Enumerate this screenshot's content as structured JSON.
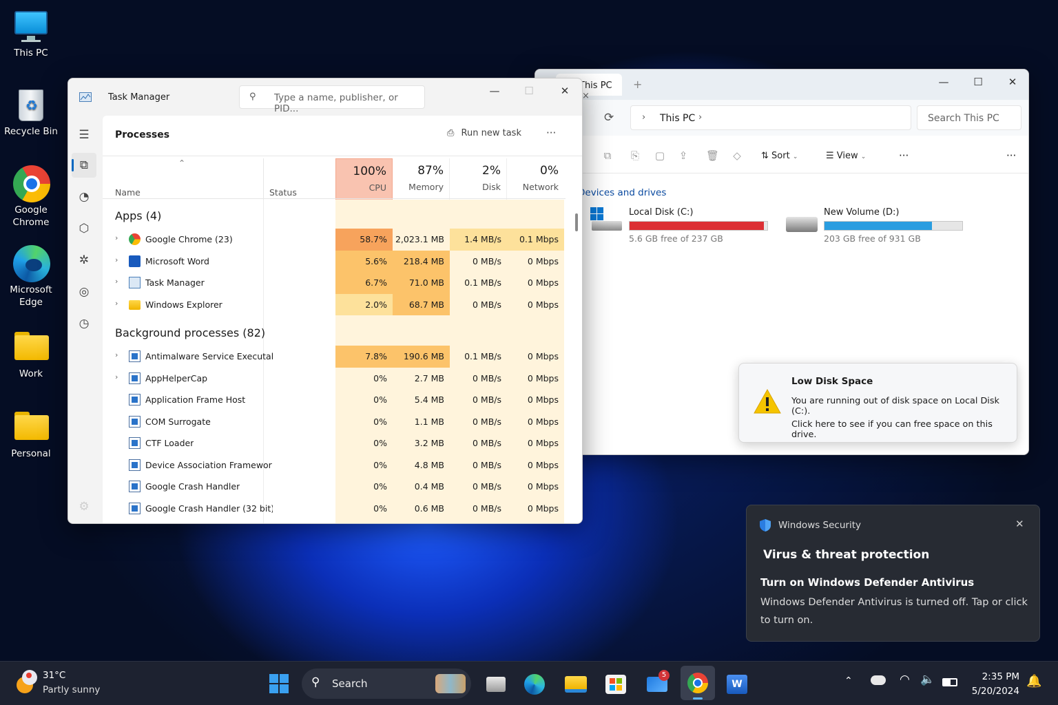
{
  "desktop": {
    "icons": [
      {
        "label": "This PC"
      },
      {
        "label": "Recycle Bin"
      },
      {
        "label": "Google Chrome"
      },
      {
        "label": "Microsoft Edge"
      },
      {
        "label": "Work"
      },
      {
        "label": "Personal"
      }
    ]
  },
  "explorer": {
    "tab_title": "This PC",
    "tab_close": "×",
    "new_tab": "+",
    "address": "This PC",
    "search_placeholder": "Search This PC",
    "toolbar": {
      "sort": "Sort",
      "view": "View",
      "more": "···"
    },
    "section": "Devices and drives",
    "drives": [
      {
        "name": "Local Disk (C:)",
        "free": "5.6 GB free of 237 GB",
        "used_fraction": 0.976,
        "color": "#dc2f34"
      },
      {
        "name": "New Volume (D:)",
        "free": "203 GB free of 931 GB",
        "used_fraction": 0.782,
        "color": "#2a9de0"
      }
    ]
  },
  "low_disk": {
    "title": "Low Disk Space",
    "line1": "You are running out of disk space on Local Disk (C:).",
    "line2": "Click here to see if you can free space on this drive."
  },
  "task_manager": {
    "title": "Task Manager",
    "search_placeholder": "Type a name, publisher, or PID...",
    "page": "Processes",
    "run_new_task": "Run new task",
    "more": "···",
    "columns": {
      "name": "Name",
      "status": "Status",
      "cpu": {
        "pct": "100%",
        "label": "CPU"
      },
      "memory": {
        "pct": "87%",
        "label": "Memory"
      },
      "disk": {
        "pct": "2%",
        "label": "Disk"
      },
      "network": {
        "pct": "0%",
        "label": "Network"
      }
    },
    "apps_header": "Apps (4)",
    "bg_header": "Background processes (82)",
    "apps": [
      {
        "name": "Google Chrome (23)",
        "cpu": "58.7%",
        "mem": "2,023.1 MB",
        "disk": "1.4 MB/s",
        "net": "0.1 Mbps",
        "icon": "chrome-icon"
      },
      {
        "name": "Microsoft Word",
        "cpu": "5.6%",
        "mem": "218.4 MB",
        "disk": "0 MB/s",
        "net": "0 Mbps",
        "icon": "word-icon"
      },
      {
        "name": "Task Manager",
        "cpu": "6.7%",
        "mem": "71.0 MB",
        "disk": "0.1 MB/s",
        "net": "0 Mbps",
        "icon": "task-manager-icon"
      },
      {
        "name": "Windows Explorer",
        "cpu": "2.0%",
        "mem": "68.7 MB",
        "disk": "0 MB/s",
        "net": "0 Mbps",
        "icon": "folder-icon"
      }
    ],
    "background": [
      {
        "name": "Antimalware Service Executable",
        "cpu": "7.8%",
        "mem": "190.6 MB",
        "disk": "0.1 MB/s",
        "net": "0 Mbps",
        "expand": true
      },
      {
        "name": "AppHelperCap",
        "cpu": "0%",
        "mem": "2.7 MB",
        "disk": "0 MB/s",
        "net": "0 Mbps",
        "expand": true
      },
      {
        "name": "Application Frame Host",
        "cpu": "0%",
        "mem": "5.4 MB",
        "disk": "0 MB/s",
        "net": "0 Mbps",
        "expand": false
      },
      {
        "name": "COM Surrogate",
        "cpu": "0%",
        "mem": "1.1 MB",
        "disk": "0 MB/s",
        "net": "0 Mbps",
        "expand": false
      },
      {
        "name": "CTF Loader",
        "cpu": "0%",
        "mem": "3.2 MB",
        "disk": "0 MB/s",
        "net": "0 Mbps",
        "expand": false
      },
      {
        "name": "Device Association Framework...",
        "cpu": "0%",
        "mem": "4.8 MB",
        "disk": "0 MB/s",
        "net": "0 Mbps",
        "expand": false
      },
      {
        "name": "Google Crash Handler",
        "cpu": "0%",
        "mem": "0.4 MB",
        "disk": "0 MB/s",
        "net": "0 Mbps",
        "expand": false
      },
      {
        "name": "Google Crash Handler (32 bit)",
        "cpu": "0%",
        "mem": "0.6 MB",
        "disk": "0 MB/s",
        "net": "0 Mbps",
        "expand": false
      }
    ]
  },
  "security_toast": {
    "app": "Windows Security",
    "heading": "Virus & threat protection",
    "title": "Turn on Windows Defender Antivirus",
    "body": "Windows Defender Antivirus is turned off. Tap or click to turn on."
  },
  "taskbar": {
    "weather": {
      "temp": "31°C",
      "desc": "Partly sunny"
    },
    "search": "Search",
    "mail_badge": "5",
    "clock": {
      "time": "2:35 PM",
      "date": "5/20/2024"
    }
  },
  "colors": {
    "cpu_hot": "#f7a35c",
    "cpu_header": "#f9c3b0",
    "accent": "#0067c0"
  }
}
